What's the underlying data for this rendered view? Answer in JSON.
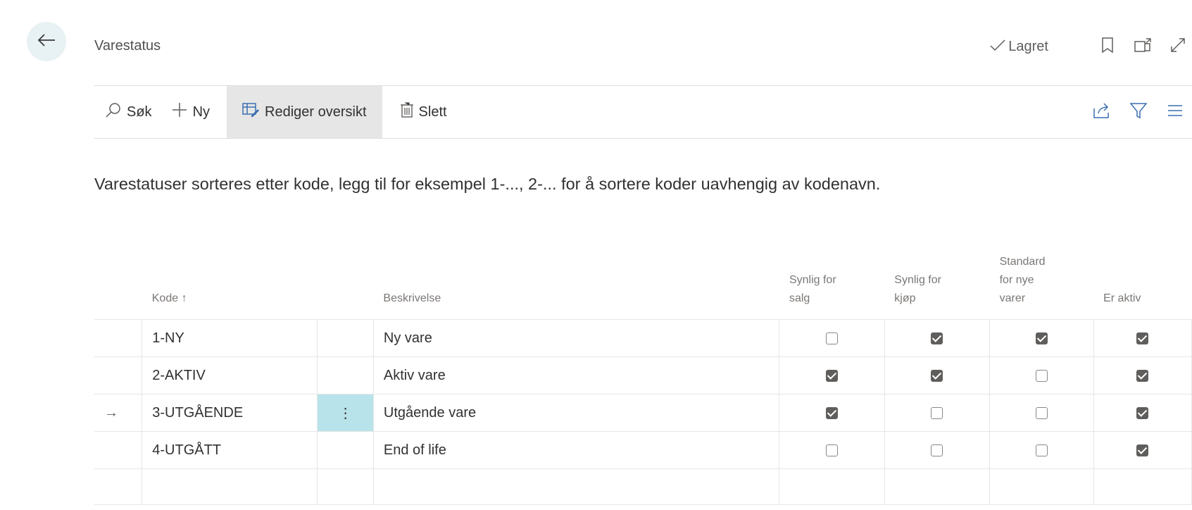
{
  "header": {
    "title": "Varestatus",
    "saved_label": "Lagret"
  },
  "toolbar": {
    "search": "Søk",
    "new": "Ny",
    "edit_list": "Rediger oversikt",
    "delete": "Slett"
  },
  "info_text": "Varestatuser sorteres etter kode, legg til for eksempel 1-..., 2-... for å sortere koder uavhengig av kodenavn.",
  "table": {
    "headers": {
      "code": "Kode ↑",
      "description": "Beskrivelse",
      "sales_1": "Synlig for",
      "sales_2": "salg",
      "purchase_1": "Synlig for",
      "purchase_2": "kjøp",
      "default_1": "Standard",
      "default_2": "for nye",
      "default_3": "varer",
      "active": "Er aktiv"
    },
    "rows": [
      {
        "code": "1-NY",
        "description": "Ny vare",
        "sales": false,
        "purchase": true,
        "default": true,
        "active": true
      },
      {
        "code": "2-AKTIV",
        "description": "Aktiv vare",
        "sales": true,
        "purchase": true,
        "default": false,
        "active": true
      },
      {
        "code": "3-UTGÅENDE",
        "description": "Utgående vare",
        "sales": true,
        "purchase": false,
        "default": false,
        "active": true,
        "selected": true
      },
      {
        "code": "4-UTGÅTT",
        "description": "End of life",
        "sales": false,
        "purchase": false,
        "default": false,
        "active": true
      }
    ]
  },
  "icons": {
    "back": "back-arrow-icon",
    "saved": "checkmark-icon",
    "bookmark": "bookmark-icon",
    "open_new": "open-in-new-window-icon",
    "expand": "expand-icon",
    "search": "search-icon",
    "new": "plus-icon",
    "edit_list": "edit-list-icon",
    "delete": "delete-icon",
    "share": "share-icon",
    "filter": "filter-icon",
    "list": "list-options-icon",
    "row_marker": "row-selected-arrow-icon",
    "row_menu": "row-menu-icon"
  },
  "colors": {
    "back_bg": "#e8f1f3",
    "active_tool_bg": "#e6e6e6",
    "selected_menu_bg": "#b9e3ea"
  }
}
